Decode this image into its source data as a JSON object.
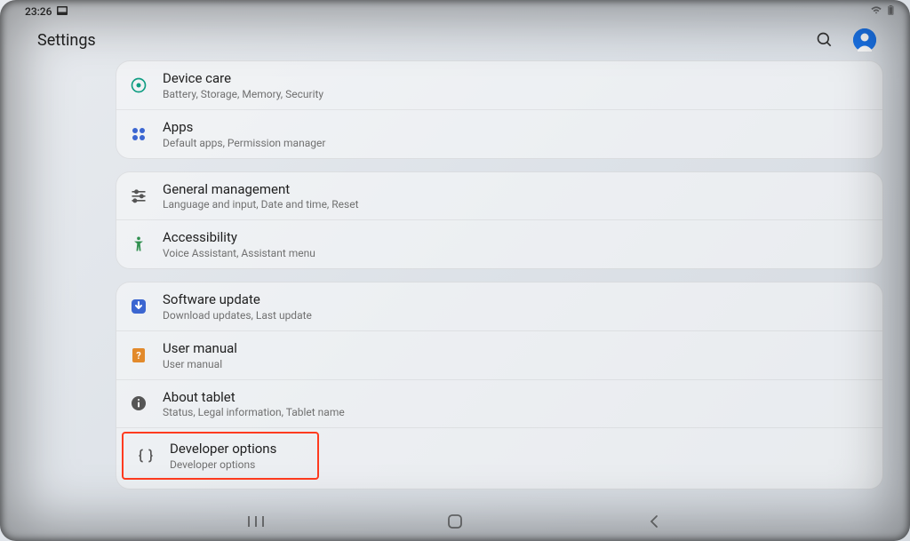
{
  "status": {
    "time": "23:26",
    "notif_icon": "image-icon"
  },
  "header": {
    "title": "Settings"
  },
  "groups": [
    {
      "items": [
        {
          "icon": "device-care-icon",
          "title": "Device care",
          "sub": "Battery, Storage, Memory, Security"
        },
        {
          "icon": "apps-icon",
          "title": "Apps",
          "sub": "Default apps, Permission manager"
        }
      ]
    },
    {
      "items": [
        {
          "icon": "sliders-icon",
          "title": "General management",
          "sub": "Language and input, Date and time, Reset"
        },
        {
          "icon": "accessibility-icon",
          "title": "Accessibility",
          "sub": "Voice Assistant, Assistant menu"
        }
      ]
    },
    {
      "items": [
        {
          "icon": "update-icon",
          "title": "Software update",
          "sub": "Download updates, Last update"
        },
        {
          "icon": "manual-icon",
          "title": "User manual",
          "sub": "User manual"
        },
        {
          "icon": "info-icon",
          "title": "About tablet",
          "sub": "Status, Legal information, Tablet name"
        },
        {
          "icon": "braces-icon",
          "title": "Developer options",
          "sub": "Developer options",
          "highlighted": true
        }
      ]
    }
  ]
}
